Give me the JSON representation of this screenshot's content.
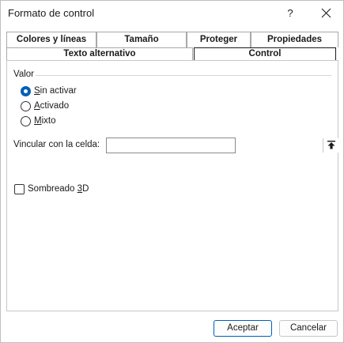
{
  "dialog": {
    "title": "Formato de control",
    "help_label": "?"
  },
  "tabs_row1": [
    {
      "label": "Colores y líneas"
    },
    {
      "label": "Tamaño"
    },
    {
      "label": "Proteger"
    },
    {
      "label": "Propiedades"
    }
  ],
  "tabs_row2": [
    {
      "label": "Texto alternativo"
    },
    {
      "label": "Control",
      "active": true
    }
  ],
  "control": {
    "group_label": "Valor",
    "radios": [
      {
        "first": "S",
        "rest": "in activar",
        "checked": true
      },
      {
        "first": "A",
        "rest": "ctivado",
        "checked": false
      },
      {
        "first": "M",
        "rest": "ixto",
        "checked": false
      }
    ],
    "link_label": "Vincular con la celda:",
    "link_value": "",
    "shading_prefix": "Sombreado ",
    "shading_mnemonic": "3",
    "shading_suffix": "D",
    "shading_checked": false
  },
  "footer": {
    "accept_label": "Aceptar",
    "cancel_label": "Cancelar"
  },
  "colors": {
    "accent": "#005fb8"
  }
}
